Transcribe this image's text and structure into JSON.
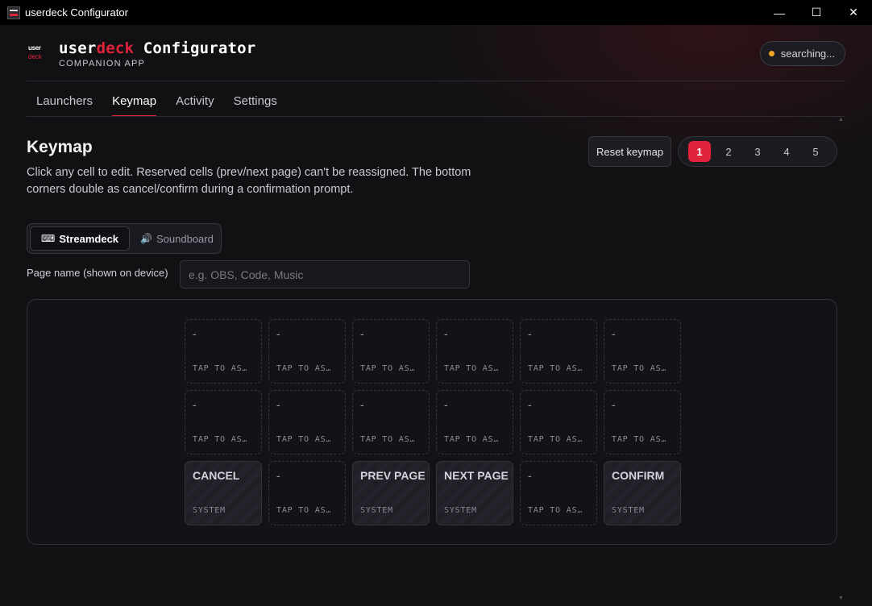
{
  "window": {
    "title": "userdeck Configurator",
    "controls": {
      "minimize": "—",
      "maximize": "☐",
      "close": "✕"
    }
  },
  "brand": {
    "logo_top": "user",
    "logo_bottom": "deck",
    "name_part1": "user",
    "name_part2": "deck",
    "name_part3": " Configurator",
    "subtitle": "COMPANION APP",
    "accent_color": "#e0223a"
  },
  "status": {
    "label": "searching...",
    "dot_color": "#f0a422"
  },
  "tabs": [
    {
      "label": "Launchers",
      "active": false
    },
    {
      "label": "Keymap",
      "active": true
    },
    {
      "label": "Activity",
      "active": false
    },
    {
      "label": "Settings",
      "active": false
    }
  ],
  "keymap": {
    "title": "Keymap",
    "description": "Click any cell to edit. Reserved cells (prev/next page) can't be reassigned. The bottom corners double as cancel/confirm during a confirmation prompt.",
    "reset_label": "Reset keymap",
    "pages": [
      "1",
      "2",
      "3",
      "4",
      "5"
    ],
    "active_page": "1",
    "modes": [
      {
        "icon": "keyboard-icon",
        "glyph": "⌨",
        "label": "Streamdeck",
        "active": true
      },
      {
        "icon": "speaker-icon",
        "glyph": "🔊",
        "label": "Soundboard",
        "active": false
      }
    ],
    "page_name_label": "Page name (shown on device)",
    "page_name_placeholder": "e.g. OBS, Code, Music",
    "page_name_value": "",
    "keys": [
      [
        {
          "title": "-",
          "sub": "TAP TO AS…",
          "reserved": false
        },
        {
          "title": "-",
          "sub": "TAP TO AS…",
          "reserved": false
        },
        {
          "title": "-",
          "sub": "TAP TO AS…",
          "reserved": false
        },
        {
          "title": "-",
          "sub": "TAP TO AS…",
          "reserved": false
        },
        {
          "title": "-",
          "sub": "TAP TO AS…",
          "reserved": false
        },
        {
          "title": "-",
          "sub": "TAP TO AS…",
          "reserved": false
        }
      ],
      [
        {
          "title": "-",
          "sub": "TAP TO AS…",
          "reserved": false
        },
        {
          "title": "-",
          "sub": "TAP TO AS…",
          "reserved": false
        },
        {
          "title": "-",
          "sub": "TAP TO AS…",
          "reserved": false
        },
        {
          "title": "-",
          "sub": "TAP TO AS…",
          "reserved": false
        },
        {
          "title": "-",
          "sub": "TAP TO AS…",
          "reserved": false
        },
        {
          "title": "-",
          "sub": "TAP TO AS…",
          "reserved": false
        }
      ],
      [
        {
          "title": "CANCEL",
          "sub": "SYSTEM",
          "reserved": true
        },
        {
          "title": "-",
          "sub": "TAP TO AS…",
          "reserved": false
        },
        {
          "title": "PREV PAGE",
          "sub": "SYSTEM",
          "reserved": true
        },
        {
          "title": "NEXT PAGE",
          "sub": "SYSTEM",
          "reserved": true
        },
        {
          "title": "-",
          "sub": "TAP TO AS…",
          "reserved": false
        },
        {
          "title": "CONFIRM",
          "sub": "SYSTEM",
          "reserved": true
        }
      ]
    ]
  }
}
